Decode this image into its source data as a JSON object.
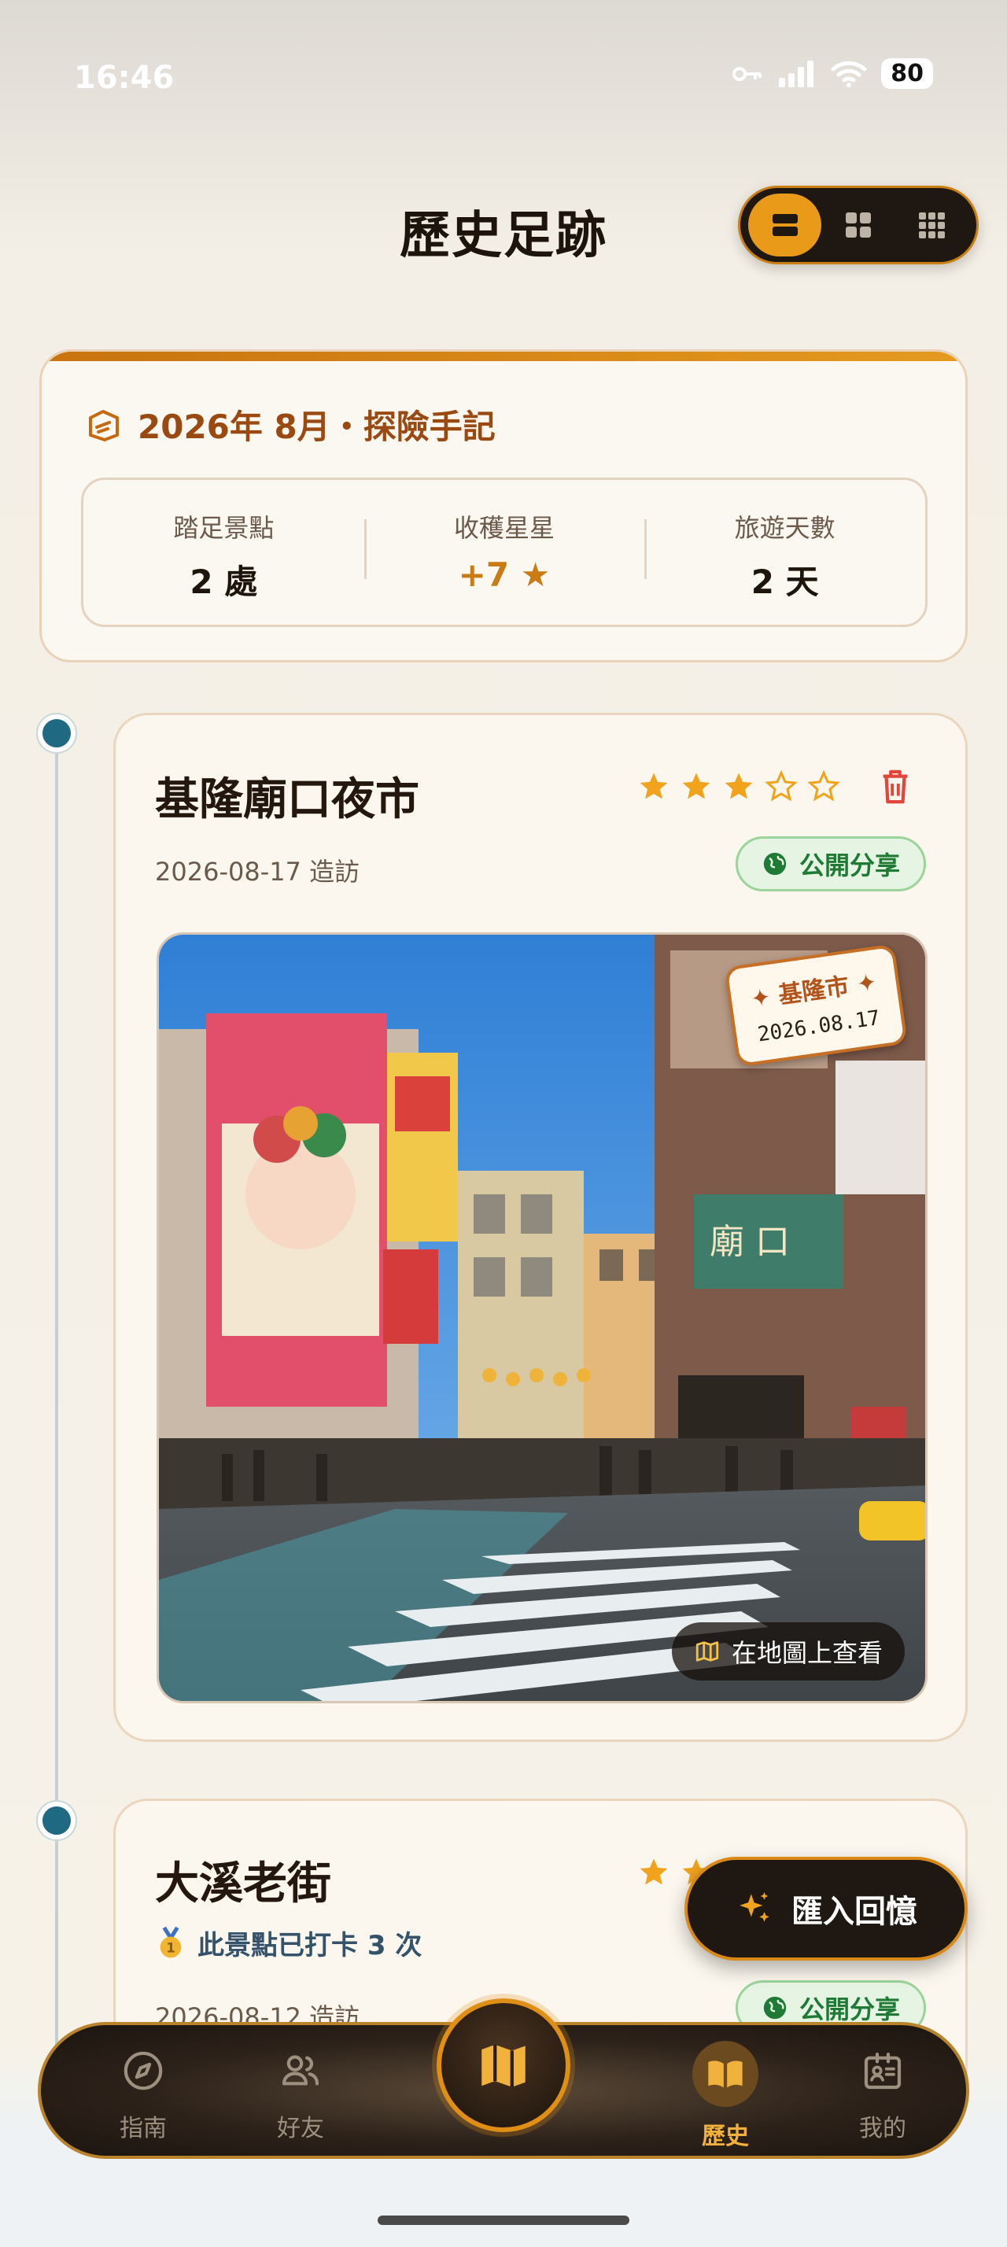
{
  "status": {
    "time": "16:46",
    "battery": "80"
  },
  "header": {
    "title": "歷史足跡"
  },
  "view_switch": [
    "list",
    "grid-2",
    "grid-3"
  ],
  "summary": {
    "title": "2026年 8月・探險手記",
    "stats": [
      {
        "label": "踏足景點",
        "value": "2 處"
      },
      {
        "label": "收穫星星",
        "value": "+7 ★"
      },
      {
        "label": "旅遊天數",
        "value": "2 天"
      }
    ]
  },
  "entries": [
    {
      "title": "基隆廟口夜市",
      "rating": 3,
      "date": "2026-08-17 造訪",
      "share": "公開分享",
      "stamp_city": "✦ 基隆市 ✦",
      "stamp_date": "2026.08.17",
      "map_link": "在地圖上查看"
    },
    {
      "title": "大溪老街",
      "rating": 3,
      "checkins": "此景點已打卡 3 次",
      "date": "2026-08-12 造訪",
      "share": "公開分享"
    }
  ],
  "fab": {
    "label": "匯入回憶"
  },
  "nav": [
    {
      "label": "指南"
    },
    {
      "label": "好友"
    },
    {
      "label": "歷史"
    },
    {
      "label": "我的"
    }
  ],
  "colors": {
    "accent": "#e89a18",
    "share_green": "#1e7a34",
    "timeline_dot": "#1f6a82",
    "star": "#f0a31b",
    "delete": "#e2453a"
  }
}
